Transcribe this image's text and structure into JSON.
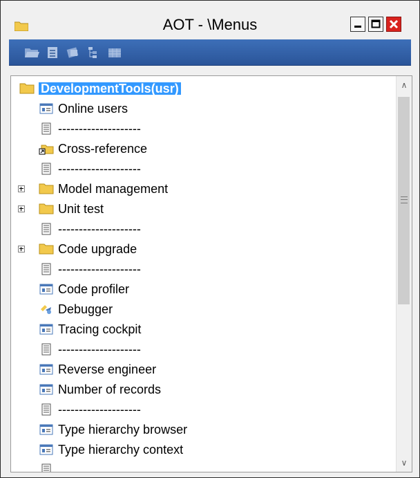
{
  "window": {
    "title": "AOT - \\Menus"
  },
  "tree": {
    "root": "DevelopmentTools(usr)",
    "items": [
      {
        "label": "Online users",
        "icon": "menu-item-display-icon",
        "expandable": false
      },
      {
        "label": "--------------------",
        "icon": "separator-icon",
        "expandable": false
      },
      {
        "label": "Cross-reference",
        "icon": "menu-reference-icon",
        "expandable": false
      },
      {
        "label": "--------------------",
        "icon": "separator-icon",
        "expandable": false
      },
      {
        "label": "Model management",
        "icon": "folder-icon",
        "expandable": true
      },
      {
        "label": "Unit test",
        "icon": "folder-icon",
        "expandable": true
      },
      {
        "label": "--------------------",
        "icon": "separator-icon",
        "expandable": false
      },
      {
        "label": "Code upgrade",
        "icon": "folder-icon",
        "expandable": true
      },
      {
        "label": "--------------------",
        "icon": "separator-icon",
        "expandable": false
      },
      {
        "label": "Code profiler",
        "icon": "menu-item-display-icon",
        "expandable": false
      },
      {
        "label": "Debugger",
        "icon": "debugger-icon",
        "expandable": false
      },
      {
        "label": "Tracing cockpit",
        "icon": "menu-item-display-icon",
        "expandable": false
      },
      {
        "label": "--------------------",
        "icon": "separator-icon",
        "expandable": false
      },
      {
        "label": "Reverse engineer",
        "icon": "menu-item-display-icon",
        "expandable": false
      },
      {
        "label": "Number of records",
        "icon": "menu-item-display-icon",
        "expandable": false
      },
      {
        "label": "--------------------",
        "icon": "separator-icon",
        "expandable": false
      },
      {
        "label": "Type hierarchy browser",
        "icon": "menu-item-display-icon",
        "expandable": false
      },
      {
        "label": "Type hierarchy context",
        "icon": "menu-item-display-icon",
        "expandable": false
      },
      {
        "label": "",
        "icon": "separator-icon",
        "expandable": false
      }
    ]
  },
  "colors": {
    "selection": "#3399ff",
    "toolbar": "#2f5fa8",
    "close": "#d9231f",
    "folder": "#f2c94c"
  }
}
